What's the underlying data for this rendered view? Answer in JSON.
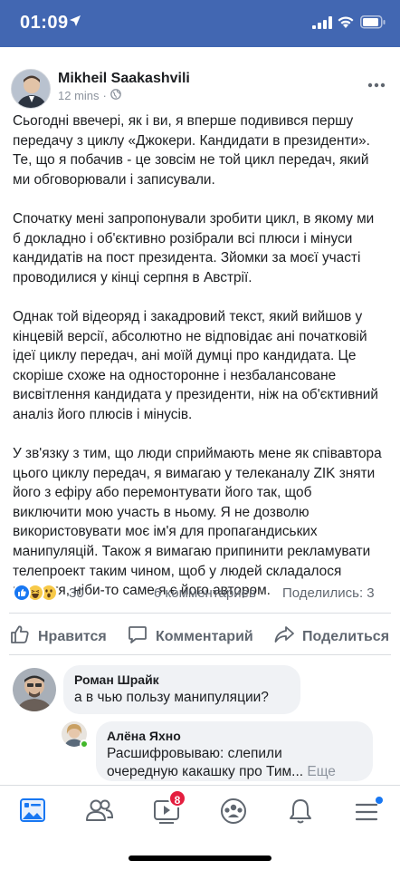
{
  "status_bar": {
    "time": "01:09",
    "location_icon": "location-arrow-icon",
    "signal_icon": "cellular-signal-icon",
    "wifi_icon": "wifi-icon",
    "battery_icon": "battery-icon",
    "background_color": "#4267b2"
  },
  "post": {
    "author": "Mikheil Saakashvili",
    "time": "12 mins",
    "privacy_icon": "globe-icon",
    "paragraphs": [
      [
        "Сьогодні ввечері, як і ви, я вперше подивився першу",
        "передачу з циклу «Джокери. Кандидати в президенти».",
        "Те, що я побачив - це зовсім не той цикл передач, який",
        "ми обговорювали і записували."
      ],
      [
        "Спочатку мені запропонували зробити цикл, в якому ми",
        "б докладно і об'єктивно розібрали всі плюси і мінуси",
        "кандидатів на пост президента. Зйомки за моєї участі",
        "проводилися у кінці серпня в Австрії."
      ],
      [
        "Однак той відеоряд і закадровий текст, який вийшов у",
        "кінцевій версії, абсолютно не відповідає ані початковій",
        "ідеї циклу передач, ані моїй думці про кандидата. Це",
        "скоріше схоже на односторонне і незбалансоване",
        "висвітлення кандидата у президенти, ніж на об'єктивний",
        "аналіз його плюсів і мінусів."
      ],
      [
        "У зв'язку з тим, що люди сприймають мене як співавтора",
        "цього циклу передач, я вимагаю у телеканалу ZIK зняти",
        "його з ефіру або перемонтувати його так, щоб",
        "виключити мою участь в ньому. Я не дозволю",
        "використовувати моє ім'я для пропагандиських",
        "манипуляцій. Також я вимагаю припинити рекламувати",
        "телепроект таким чином, щоб у людей складалося",
        "відчуття, ніби-то саме я є його автором."
      ]
    ],
    "reaction_icons": [
      "like-reaction-icon",
      "haha-reaction-icon",
      "wow-reaction-icon"
    ],
    "reactions_count": "30",
    "comments_count": "6 комментариев",
    "shares_count": "Поделились: 3"
  },
  "actions": {
    "like": "Нравится",
    "comment": "Комментарий",
    "share": "Поделиться"
  },
  "comments": [
    {
      "author": "Роман Шрайк",
      "text": "а в чью пользу манипуляции?"
    },
    {
      "author": "Алёна Яхно",
      "text_line1": "Расшифровываю: слепили",
      "text_line2": "очередную какашку про Тим...",
      "more": "Еще"
    }
  ],
  "tab_bar": {
    "items": [
      "news-feed-icon",
      "friends-icon",
      "watch-icon",
      "groups-icon",
      "notifications-icon",
      "menu-icon"
    ],
    "watch_badge": "8",
    "accent_color": "#1877f2"
  }
}
